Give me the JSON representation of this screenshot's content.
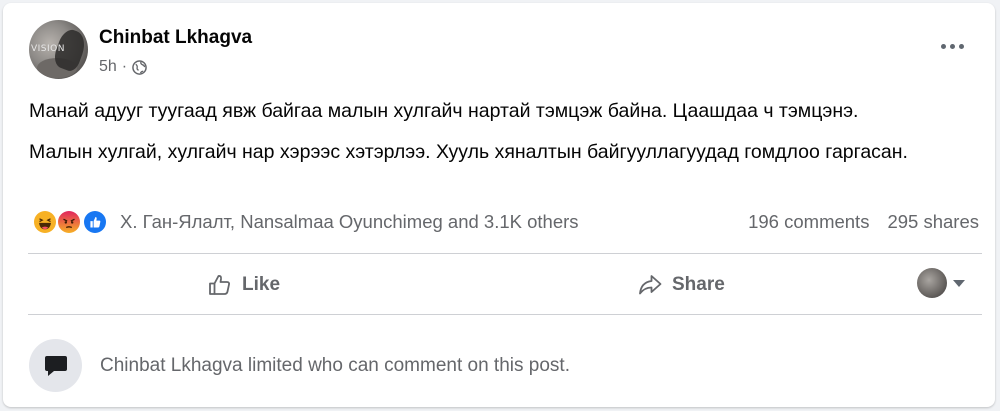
{
  "post": {
    "author": "Chinbat Lkhagva",
    "time": "5h",
    "avatar_watermark": "VISION",
    "paragraphs": [
      "Манай адууг туугаад явж байгаа малын хулгайч нартай тэмцэж байна. Цаашдаа ч тэмцэнэ.",
      "Малын хулгай, хулгайч нар хэрээс хэтэрлээ. Хууль хяналтын байгууллагуудад гомдлоо гаргасан."
    ]
  },
  "reactions": {
    "icons": [
      "haha-icon",
      "angry-icon",
      "like-icon"
    ],
    "summary": "Х. Ган-Ялалт, Nansalmaa Oyunchimeg and 3.1K others"
  },
  "counts": {
    "comments": "196 comments",
    "shares": "295 shares"
  },
  "actions": {
    "like_label": "Like",
    "share_label": "Share"
  },
  "footer": {
    "limited_text": "Chinbat Lkhagva limited who can comment on this post."
  },
  "colors": {
    "background": "#f0f2f5",
    "card": "#ffffff",
    "secondary_text": "#65676b",
    "like_blue": "#1877f2",
    "haha_yellow": "#f7b125",
    "angry_red": "#e9710f"
  }
}
